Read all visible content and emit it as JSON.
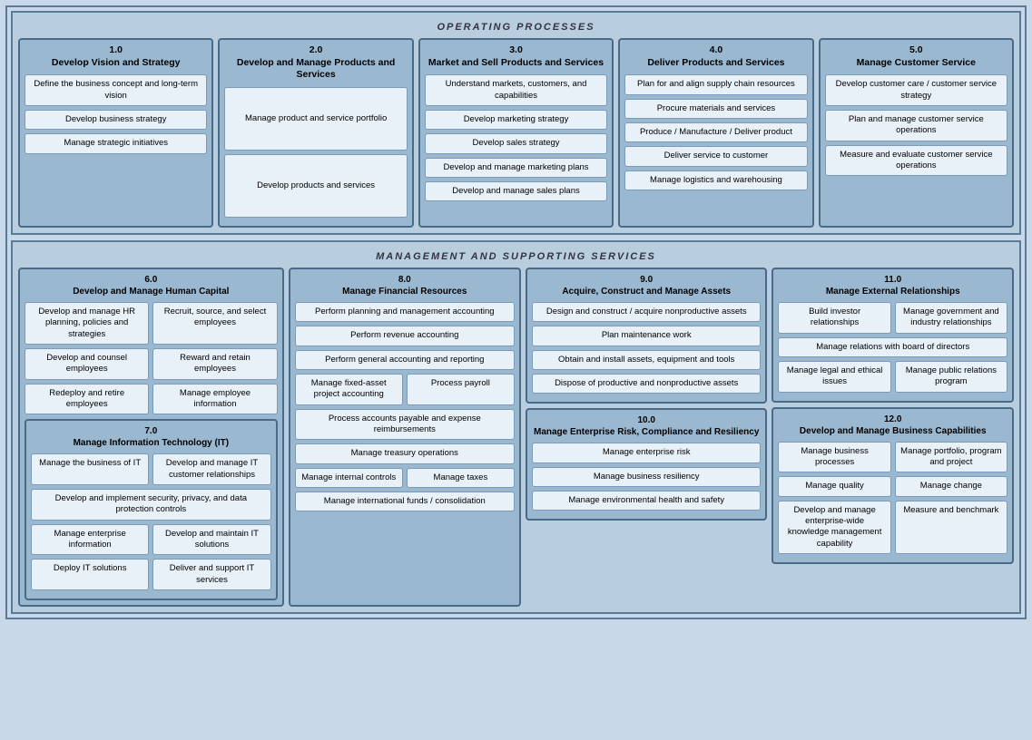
{
  "op_header": "OPERATING PROCESSES",
  "mgmt_header": "MANAGEMENT AND SUPPORTING SERVICES",
  "col1": {
    "num": "1.0",
    "title": "Develop Vision and Strategy",
    "items": [
      {
        "id": "1.1",
        "text": "Define the business concept and long-term vision"
      },
      {
        "id": "1.2",
        "text": "Develop business strategy"
      },
      {
        "id": "1.3",
        "text": "Manage strategic initiatives"
      }
    ]
  },
  "col2": {
    "num": "2.0",
    "title": "Develop and Manage Products and Services",
    "items": [
      {
        "id": "2.1",
        "text": "Manage product and service portfolio"
      },
      {
        "id": "2.2",
        "text": "Develop products and services"
      }
    ]
  },
  "col3": {
    "num": "3.0",
    "title": "Market and Sell Products and Services",
    "items": [
      {
        "id": "3.1",
        "text": "Understand markets, customers, and capabilities"
      },
      {
        "id": "3.2",
        "text": "Develop marketing strategy"
      },
      {
        "id": "3.3",
        "text": "Develop sales strategy"
      },
      {
        "id": "3.4",
        "text": "Develop and manage marketing plans"
      },
      {
        "id": "3.5",
        "text": "Develop and manage sales plans"
      }
    ]
  },
  "col4": {
    "num": "4.0",
    "title": "Deliver Products and Services",
    "items": [
      {
        "id": "4.1",
        "text": "Plan for and align supply chain resources"
      },
      {
        "id": "4.2",
        "text": "Procure materials and services"
      },
      {
        "id": "4.3",
        "text": "Produce / Manufacture / Deliver product"
      },
      {
        "id": "4.4",
        "text": "Deliver service to customer"
      },
      {
        "id": "4.5",
        "text": "Manage logistics and warehousing"
      }
    ]
  },
  "col5": {
    "num": "5.0",
    "title": "Manage Customer Service",
    "items": [
      {
        "id": "5.1",
        "text": "Develop customer care / customer service strategy"
      },
      {
        "id": "5.2",
        "text": "Plan and manage customer service operations"
      },
      {
        "id": "5.3",
        "text": "Measure and evaluate customer service operations"
      }
    ]
  },
  "col6": {
    "num": "6.0",
    "title": "Develop and Manage Human Capital",
    "row1": [
      {
        "id": "6.1",
        "text": "Develop and manage HR planning, policies and strategies"
      },
      {
        "id": "6.2",
        "text": "Recruit, source, and select employees"
      }
    ],
    "row2": [
      {
        "id": "6.3",
        "text": "Develop and counsel employees"
      },
      {
        "id": "6.4",
        "text": "Reward and retain employees"
      }
    ],
    "row3": [
      {
        "id": "6.5",
        "text": "Redeploy and retire employees"
      },
      {
        "id": "6.6",
        "text": "Manage employee information"
      }
    ]
  },
  "col7": {
    "num": "7.0",
    "title": "Manage Information Technology (IT)",
    "row1": [
      {
        "id": "7.1",
        "text": "Manage the business of IT"
      },
      {
        "id": "7.2",
        "text": "Develop and manage IT customer relationships"
      }
    ],
    "row2": [
      {
        "id": "7.3",
        "text": "Develop and implement security, privacy, and data protection controls"
      }
    ],
    "row3": [
      {
        "id": "7.4",
        "text": "Manage enterprise information"
      },
      {
        "id": "7.5",
        "text": "Develop and maintain IT solutions"
      }
    ],
    "row4": [
      {
        "id": "7.6",
        "text": "Deploy IT solutions"
      },
      {
        "id": "7.7",
        "text": "Deliver and support IT services"
      }
    ]
  },
  "col8": {
    "num": "8.0",
    "title": "Manage Financial Resources",
    "items": [
      {
        "id": "8.1",
        "text": "Perform planning and management accounting"
      },
      {
        "id": "8.2",
        "text": "Perform revenue accounting"
      },
      {
        "id": "8.3",
        "text": "Perform general accounting and reporting"
      }
    ],
    "row_84_85": [
      {
        "id": "8.4",
        "text": "Manage fixed-asset project accounting"
      },
      {
        "id": "8.5",
        "text": "Process payroll"
      }
    ],
    "items2": [
      {
        "id": "8.6",
        "text": "Process accounts payable and expense reimbursements"
      },
      {
        "id": "8.7",
        "text": "Manage treasury operations"
      }
    ],
    "row_88_89": [
      {
        "id": "8.8",
        "text": "Manage internal controls"
      },
      {
        "id": "8.9",
        "text": "Manage taxes"
      }
    ],
    "items3": [
      {
        "id": "8.10",
        "text": "Manage international funds / consolidation"
      }
    ]
  },
  "col9": {
    "num": "9.0",
    "title": "Acquire, Construct and Manage Assets",
    "items": [
      {
        "id": "9.1",
        "text": "Design and construct / acquire nonproductive assets"
      },
      {
        "id": "9.2",
        "text": "Plan maintenance work"
      },
      {
        "id": "9.3",
        "text": "Obtain and install assets, equipment and tools"
      },
      {
        "id": "9.4",
        "text": "Dispose of productive and nonproductive assets"
      }
    ]
  },
  "col10": {
    "num": "10.0",
    "title": "Manage Enterprise Risk, Compliance and Resiliency",
    "items": [
      {
        "id": "10.1",
        "text": "Manage enterprise risk"
      },
      {
        "id": "10.2",
        "text": "Manage business resiliency"
      },
      {
        "id": "10.3",
        "text": "Manage environmental health and safety"
      }
    ]
  },
  "col11": {
    "num": "11.0",
    "title": "Manage External Relationships",
    "row1": [
      {
        "id": "11.1",
        "text": "Build investor relationships"
      },
      {
        "id": "11.2",
        "text": "Manage government and industry relationships"
      }
    ],
    "items": [
      {
        "id": "11.3",
        "text": "Manage relations with board of directors"
      }
    ],
    "row2": [
      {
        "id": "11.4",
        "text": "Manage legal and ethical issues"
      },
      {
        "id": "11.5",
        "text": "Manage public relations program"
      }
    ]
  },
  "col12": {
    "num": "12.0",
    "title": "Develop and Manage Business Capabilities",
    "row1": [
      {
        "id": "12.1",
        "text": "Manage business processes"
      },
      {
        "id": "12.2",
        "text": "Manage portfolio, program and project"
      }
    ],
    "row2": [
      {
        "id": "12.3",
        "text": "Manage quality"
      },
      {
        "id": "12.4",
        "text": "Manage change"
      }
    ],
    "row3": [
      {
        "id": "12.5",
        "text": "Develop and manage enterprise-wide knowledge management capability"
      },
      {
        "id": "12.6",
        "text": "Measure and benchmark"
      }
    ]
  }
}
